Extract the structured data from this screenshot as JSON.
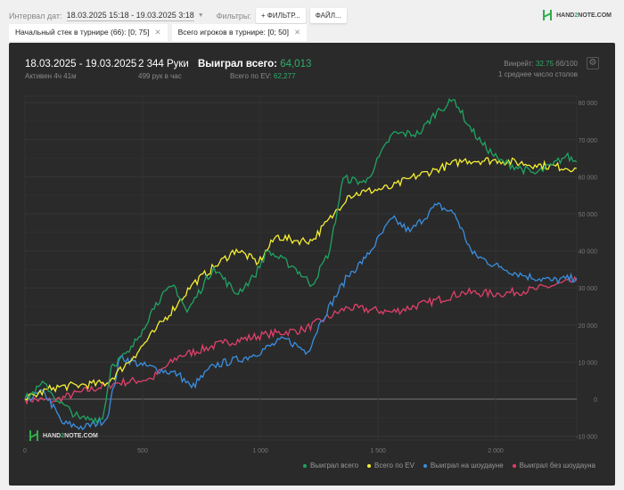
{
  "toolbar": {
    "date_label": "Интервал дат:",
    "date_value": "18.03.2025 15:18 - 19.03.2025 3:18",
    "filters_label": "Фильтры:",
    "filter_button": "+ ФИЛЬТР...",
    "file_button": "ФАЙЛ..."
  },
  "brand": {
    "logo_prefix": "HAND",
    "logo_mid": "2",
    "logo_suffix": "NOTE.COM"
  },
  "chips": [
    {
      "label": "Начальный стек в турнире (66): [0; 75]"
    },
    {
      "label": "Всего игроков в турнире: [0; 50]"
    }
  ],
  "summary": {
    "dates": "18.03.2025 - 19.03.2025",
    "active": "Активен 4ч 41м",
    "hands": "2 344 Руки",
    "hands_per_hour": "499 рук в час",
    "won_label": "Выиграл всего:",
    "won_value": "64,013",
    "ev_label": "Всего по EV:",
    "ev_value": "62,277",
    "winrate_label": "Винрейт:",
    "winrate_value": "32.75",
    "winrate_unit": "бб/100",
    "tables": "1 среднее число столов"
  },
  "chart_data": {
    "type": "line",
    "xlim": [
      0,
      2344
    ],
    "ylim": [
      -12000,
      84000
    ],
    "x_ticks": [
      {
        "v": 0,
        "label": "0"
      },
      {
        "v": 500,
        "label": "500"
      },
      {
        "v": 1000,
        "label": "1 000"
      },
      {
        "v": 1500,
        "label": "1 500"
      },
      {
        "v": 2000,
        "label": "2 000"
      }
    ],
    "y_ticks": [
      {
        "v": -10000,
        "label": "-10 000"
      },
      {
        "v": 0,
        "label": "0"
      },
      {
        "v": 10000,
        "label": "10 000"
      },
      {
        "v": 20000,
        "label": "20 000"
      },
      {
        "v": 30000,
        "label": "30 000"
      },
      {
        "v": 40000,
        "label": "40 000"
      },
      {
        "v": 50000,
        "label": "50 000"
      },
      {
        "v": 60000,
        "label": "60 000"
      },
      {
        "v": 70000,
        "label": "70 000"
      },
      {
        "v": 80000,
        "label": "80 000"
      }
    ],
    "series": [
      {
        "name": "Выиграл всего",
        "color": "#1fa463",
        "points": [
          [
            0,
            0
          ],
          [
            83,
            4300
          ],
          [
            140,
            -500
          ],
          [
            235,
            -5300
          ],
          [
            330,
            -5300
          ],
          [
            367,
            9000
          ],
          [
            443,
            12700
          ],
          [
            500,
            18800
          ],
          [
            557,
            26000
          ],
          [
            633,
            30800
          ],
          [
            689,
            23500
          ],
          [
            803,
            35600
          ],
          [
            898,
            28400
          ],
          [
            973,
            33000
          ],
          [
            1030,
            40000
          ],
          [
            1144,
            35600
          ],
          [
            1220,
            30800
          ],
          [
            1295,
            40000
          ],
          [
            1352,
            59600
          ],
          [
            1447,
            58400
          ],
          [
            1561,
            71600
          ],
          [
            1674,
            71600
          ],
          [
            1750,
            77600
          ],
          [
            1826,
            80800
          ],
          [
            1883,
            74000
          ],
          [
            1939,
            69200
          ],
          [
            2015,
            64400
          ],
          [
            2167,
            60800
          ],
          [
            2242,
            63200
          ],
          [
            2299,
            65600
          ],
          [
            2344,
            64013
          ]
        ]
      },
      {
        "name": "Всего по EV",
        "color": "#f5f032",
        "points": [
          [
            0,
            0
          ],
          [
            121,
            3100
          ],
          [
            235,
            3800
          ],
          [
            348,
            4300
          ],
          [
            462,
            11500
          ],
          [
            557,
            18800
          ],
          [
            652,
            26000
          ],
          [
            708,
            30800
          ],
          [
            803,
            35600
          ],
          [
            898,
            40400
          ],
          [
            992,
            36800
          ],
          [
            1068,
            44000
          ],
          [
            1144,
            42800
          ],
          [
            1220,
            42800
          ],
          [
            1314,
            50000
          ],
          [
            1371,
            54800
          ],
          [
            1447,
            56000
          ],
          [
            1561,
            57200
          ],
          [
            1636,
            59600
          ],
          [
            1750,
            62000
          ],
          [
            1864,
            64400
          ],
          [
            2015,
            64400
          ],
          [
            2167,
            63200
          ],
          [
            2344,
            62277
          ]
        ]
      },
      {
        "name": "Выиграл на шоудауне",
        "color": "#3a8fe0",
        "points": [
          [
            0,
            0
          ],
          [
            83,
            1900
          ],
          [
            159,
            -6500
          ],
          [
            253,
            -7700
          ],
          [
            348,
            -5300
          ],
          [
            405,
            11500
          ],
          [
            500,
            9100
          ],
          [
            652,
            6700
          ],
          [
            708,
            3100
          ],
          [
            803,
            9100
          ],
          [
            955,
            11500
          ],
          [
            1106,
            16300
          ],
          [
            1201,
            12700
          ],
          [
            1258,
            21100
          ],
          [
            1371,
            33200
          ],
          [
            1447,
            38000
          ],
          [
            1561,
            48800
          ],
          [
            1636,
            45200
          ],
          [
            1750,
            52400
          ],
          [
            1826,
            50000
          ],
          [
            1902,
            39200
          ],
          [
            2015,
            35600
          ],
          [
            2129,
            33200
          ],
          [
            2242,
            32000
          ],
          [
            2344,
            32700
          ]
        ]
      },
      {
        "name": "Выиграл без шоудауна",
        "color": "#e0406a",
        "points": [
          [
            0,
            0
          ],
          [
            121,
            -500
          ],
          [
            235,
            1900
          ],
          [
            386,
            4300
          ],
          [
            538,
            5500
          ],
          [
            652,
            11500
          ],
          [
            841,
            15100
          ],
          [
            1030,
            17500
          ],
          [
            1182,
            18700
          ],
          [
            1371,
            24700
          ],
          [
            1561,
            23500
          ],
          [
            1712,
            26000
          ],
          [
            1864,
            28800
          ],
          [
            2015,
            28400
          ],
          [
            2167,
            29600
          ],
          [
            2344,
            32000
          ]
        ]
      }
    ]
  }
}
